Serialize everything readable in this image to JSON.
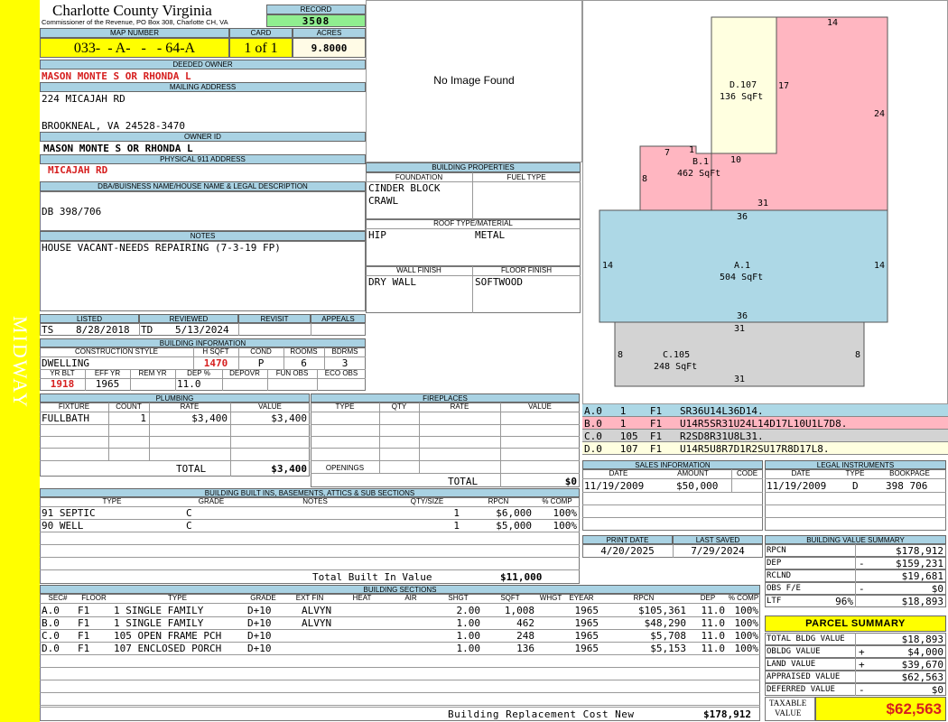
{
  "side_label": "MIDWAY",
  "header": {
    "county": "Charlotte County Virginia",
    "commissioner": "Commissioner of the Revenue, PO Box 308, Charlotte CH, VA",
    "record_label": "RECORD",
    "record_value": "3508"
  },
  "parcel_id": {
    "map_label": "MAP NUMBER",
    "map_value": "033-  - A-   -   - 64-A",
    "card_label": "CARD",
    "card_value": "1 of 1",
    "acres_label": "ACRES",
    "acres_value": "9.8000"
  },
  "owner": {
    "deeded_label": "DEEDED OWNER",
    "deeded_value": "MASON MONTE S OR RHONDA L",
    "mailing_label": "MAILING ADDRESS",
    "mailing_line1": "224 MICAJAH RD",
    "mailing_line2": "BROOKNEAL, VA 24528-3470",
    "owner_id_label": "OWNER ID",
    "owner_id_value": "MASON MONTE S OR RHONDA L",
    "physical_label": "PHYSICAL 911 ADDRESS",
    "physical_value": "MICAJAH RD"
  },
  "legal": {
    "label": "DBA/BUISNESS NAME/HOUSE NAME & LEGAL DESCRIPTION",
    "value": "DB 398/706"
  },
  "notes": {
    "label": "NOTES",
    "value": "HOUSE VACANT-NEEDS REPAIRING (7-3-19 FP)"
  },
  "photo": {
    "text": "No Image Found"
  },
  "building_props": {
    "label": "BUILDING PROPERTIES",
    "foundation_label": "FOUNDATION",
    "fuel_label": "FUEL TYPE",
    "foundation_l1": "CINDER BLOCK",
    "foundation_l2": "CRAWL",
    "roof_label": "ROOF TYPE/MATERIAL",
    "roof_type": "HIP",
    "roof_material": "METAL",
    "wall_label": "WALL FINISH",
    "floor_label": "FLOOR FINISH",
    "wall_value": "DRY WALL",
    "floor_value": "SOFTWOOD"
  },
  "listing": {
    "listed_label": "LISTED",
    "reviewed_label": "REVIEWED",
    "revisit_label": "REVISIT",
    "appeals_label": "APPEALS",
    "listed_by": "TS",
    "listed_date": "8/28/2018",
    "reviewed_by": "TD",
    "reviewed_date": "5/13/2024"
  },
  "building_info": {
    "label": "BUILDING INFORMATION",
    "style_label": "CONSTRUCTION STYLE",
    "hsqft_label": "H SQFT",
    "cond_label": "COND",
    "rooms_label": "ROOMS",
    "bdrms_label": "BDRMS",
    "style": "DWELLING",
    "hsqft": "1470",
    "cond": "P",
    "rooms": "6",
    "bdrms": "3",
    "yrblt_label": "YR BLT",
    "effyr_label": "EFF YR",
    "remyr_label": "REM YR",
    "dep_label": "DEP %",
    "depovr_label": "DEPOVR",
    "funobs_label": "FUN OBS",
    "ecoobs_label": "ECO OBS",
    "yrblt": "1918",
    "effyr": "1965",
    "dep": "11.0"
  },
  "plumbing": {
    "label": "PLUMBING",
    "headers": [
      "FIXTURE",
      "COUNT",
      "RATE",
      "VALUE"
    ],
    "rows": [
      [
        "FULLBATH",
        "1",
        "$3,400",
        "$3,400"
      ]
    ],
    "total_label": "TOTAL",
    "total": "$3,400"
  },
  "fireplaces": {
    "label": "FIREPLACES",
    "headers": [
      "TYPE",
      "QTY",
      "RATE",
      "VALUE"
    ],
    "openings_label": "OPENINGS",
    "total_label": "TOTAL",
    "total": "$0"
  },
  "builtins": {
    "label": "BUILDING BUILT INS, BASEMENTS, ATTICS & SUB SECTIONS",
    "headers": [
      "TYPE",
      "GRADE",
      "NOTES",
      "QTY/SIZE",
      "RPCN",
      "% COMP"
    ],
    "rows": [
      [
        "91 SEPTIC",
        "C",
        "",
        "1",
        "$6,000",
        "100%"
      ],
      [
        "90 WELL",
        "C",
        "",
        "1",
        "$5,000",
        "100%"
      ]
    ],
    "total_label": "Total Built In Value",
    "total": "$11,000"
  },
  "sections": {
    "label": "BUILDING SECTIONS",
    "headers": [
      "SEC#",
      "FLOOR",
      "TYPE",
      "GRADE",
      "EXT FIN",
      "HEAT",
      "AIR",
      "SHGT",
      "SQFT",
      "WHGT",
      "EYEAR",
      "RPCN",
      "DEP",
      "% COMP"
    ],
    "rows": [
      [
        "A.0",
        "F1",
        "1 SINGLE FAMILY",
        "D+10",
        "ALVYN",
        "",
        "",
        "2.00",
        "1,008",
        "",
        "1965",
        "$105,361",
        "11.0",
        "100%"
      ],
      [
        "B.0",
        "F1",
        "1 SINGLE FAMILY",
        "D+10",
        "ALVYN",
        "",
        "",
        "1.00",
        "462",
        "",
        "1965",
        "$48,290",
        "11.0",
        "100%"
      ],
      [
        "C.0",
        "F1",
        "105 OPEN FRAME PCH",
        "D+10",
        "",
        "",
        "",
        "1.00",
        "248",
        "",
        "1965",
        "$5,708",
        "11.0",
        "100%"
      ],
      [
        "D.0",
        "F1",
        "107 ENCLOSED PORCH",
        "D+10",
        "",
        "",
        "",
        "1.00",
        "136",
        "",
        "1965",
        "$5,153",
        "11.0",
        "100%"
      ]
    ],
    "total_label": "Building Replacement Cost New",
    "total": "$178,912"
  },
  "sketch": {
    "D": {
      "name": "D.107",
      "area": "136 SqFt"
    },
    "B": {
      "name": "B.1",
      "area": "462 SqFt"
    },
    "A": {
      "name": "A.1",
      "area": "504 SqFt"
    },
    "C": {
      "name": "C.105",
      "area": "248 SqFt"
    },
    "dims": {
      "d_top": "14",
      "d_right": "17",
      "big_right": "24",
      "b_7": "7",
      "b_1": "1",
      "b_10": "10",
      "b_8": "8",
      "b_31": "31",
      "a_top": "36",
      "a_left": "14",
      "a_right": "14",
      "a_bot": "36",
      "c_top": "31",
      "c_left": "8",
      "c_right": "8",
      "c_bot": "31"
    },
    "colors": {
      "D": "#ffffe0",
      "B": "#ffb6c1",
      "A": "#add8e6",
      "C": "#d3d3d3"
    }
  },
  "vectors": [
    {
      "text": "A.0   1    F1   SR36U14L36D14.",
      "color": "#add8e6"
    },
    {
      "text": "B.0   1    F1   U14R5SR31U24L14D17L10U1L7D8.",
      "color": "#ffb6c1"
    },
    {
      "text": "C.0   105  F1   R2SD8R31U8L31.",
      "color": "#d3d3d3"
    },
    {
      "text": "D.0   107  F1   U14R5U8R7D1R2SU17R8D17L8.",
      "color": "#ffffe0"
    }
  ],
  "sales": {
    "label": "SALES INFORMATION",
    "headers": [
      "DATE",
      "AMOUNT",
      "CODE"
    ],
    "rows": [
      [
        "11/19/2009",
        "$50,000",
        ""
      ]
    ]
  },
  "legal_inst": {
    "label": "LEGAL INSTRUMENTS",
    "headers": [
      "DATE",
      "TYPE",
      "BOOKPAGE"
    ],
    "rows": [
      [
        "11/19/2009",
        "D",
        "398 706"
      ]
    ]
  },
  "dates": {
    "print_label": "PRINT DATE",
    "saved_label": "LAST SAVED",
    "print_value": "4/20/2025",
    "saved_value": "7/29/2024"
  },
  "value_summary": {
    "label": "BUILDING VALUE SUMMARY",
    "rows": [
      {
        "k": "RPCN",
        "s": "",
        "v": "$178,912"
      },
      {
        "k": "DEP",
        "s": "-",
        "v": "$159,231"
      },
      {
        "k": "RCLND",
        "s": "",
        "v": "$19,681"
      },
      {
        "k": "OBS F/E",
        "s": "-",
        "v": "$0"
      },
      {
        "k": "LTF",
        "p": "96%",
        "s": "",
        "v": "$18,893"
      }
    ]
  },
  "parcel_summary": {
    "label": "PARCEL SUMMARY",
    "rows": [
      {
        "k": "TOTAL BLDG VALUE",
        "s": "",
        "v": "$18,893"
      },
      {
        "k": "OBLDG VALUE",
        "s": "+",
        "v": "$4,000"
      },
      {
        "k": "LAND VALUE",
        "s": "+",
        "v": "$39,670"
      },
      {
        "k": "APPRAISED VALUE",
        "s": "",
        "v": "$62,563"
      },
      {
        "k": "DEFERRED VALUE",
        "s": "-",
        "v": "$0"
      }
    ],
    "taxable_l1": "TAXABLE",
    "taxable_l2": "VALUE",
    "taxable_value": "$62,563"
  }
}
